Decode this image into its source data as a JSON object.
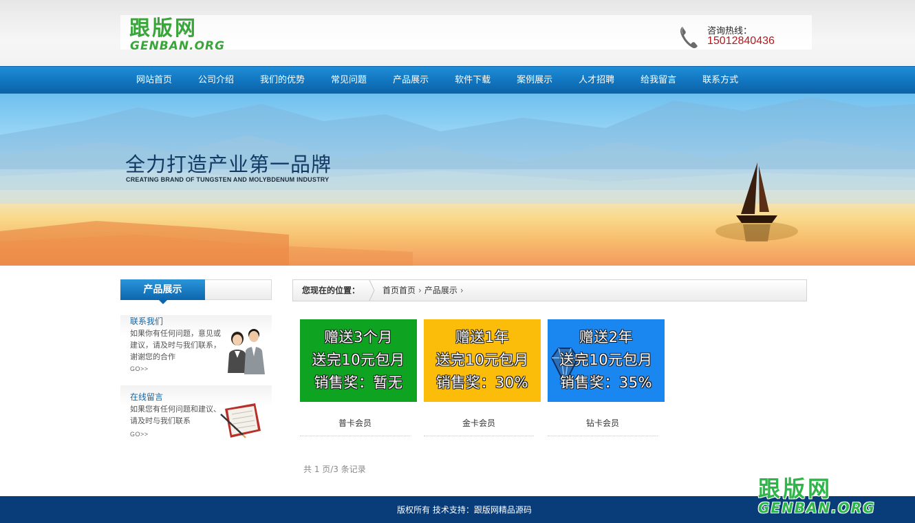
{
  "header": {
    "logo_cn": "跟版网",
    "logo_en": "GENBAN.ORG",
    "hotline_label": "咨询热线：",
    "hotline_number": "15012840436"
  },
  "nav": {
    "items": [
      "网站首页",
      "公司介绍",
      "我们的优势",
      "常见问题",
      "产品展示",
      "软件下载",
      "案例展示",
      "人才招聘",
      "给我留言",
      "联系方式"
    ]
  },
  "banner": {
    "title": "全力打造产业第一品牌",
    "subtitle": "CREATING BRAND OF TUNGSTEN AND MOLYBDENUM INDUSTRY"
  },
  "sidebar": {
    "heading": "产品展示",
    "contact": {
      "title": "联系我们",
      "text": "如果你有任何问题，意见或建议，请及时与我们联系，谢谢您的合作",
      "go": "GO>>"
    },
    "message": {
      "title": "在线留言",
      "text": "如果您有任何问题和建议、请及时与我们联系",
      "go": "GO>>"
    }
  },
  "breadcrumb": {
    "label": "您现在的位置：",
    "items": [
      "首页首页",
      "产品展示"
    ]
  },
  "products": [
    {
      "name": "普卡会员",
      "line1": "赠送3个月",
      "line2": "送完10元包月",
      "line3": "销售奖：暂无",
      "color": "#0ea421"
    },
    {
      "name": "金卡会员",
      "line1": "赠送1年",
      "line2": "送完10元包月",
      "line3": "销售奖：30%",
      "color": "#fbbd0a"
    },
    {
      "name": "钻卡会员",
      "line1": "赠送2年",
      "line2": "送完10元包月",
      "line3": "销售奖：35%",
      "color": "#1a86f0"
    }
  ],
  "pager": {
    "text": "共 1 页/3 条记录"
  },
  "footer": {
    "text": "版权所有  技术支持：跟版网精品源码"
  },
  "watermark": {
    "cn": "跟版网",
    "en": "GENBAN.ORG"
  },
  "colors": {
    "nav_blue": "#1379c3",
    "footer_blue": "#083d7a",
    "logo_green": "#3aa53a",
    "hotline_red": "#b8161b"
  }
}
